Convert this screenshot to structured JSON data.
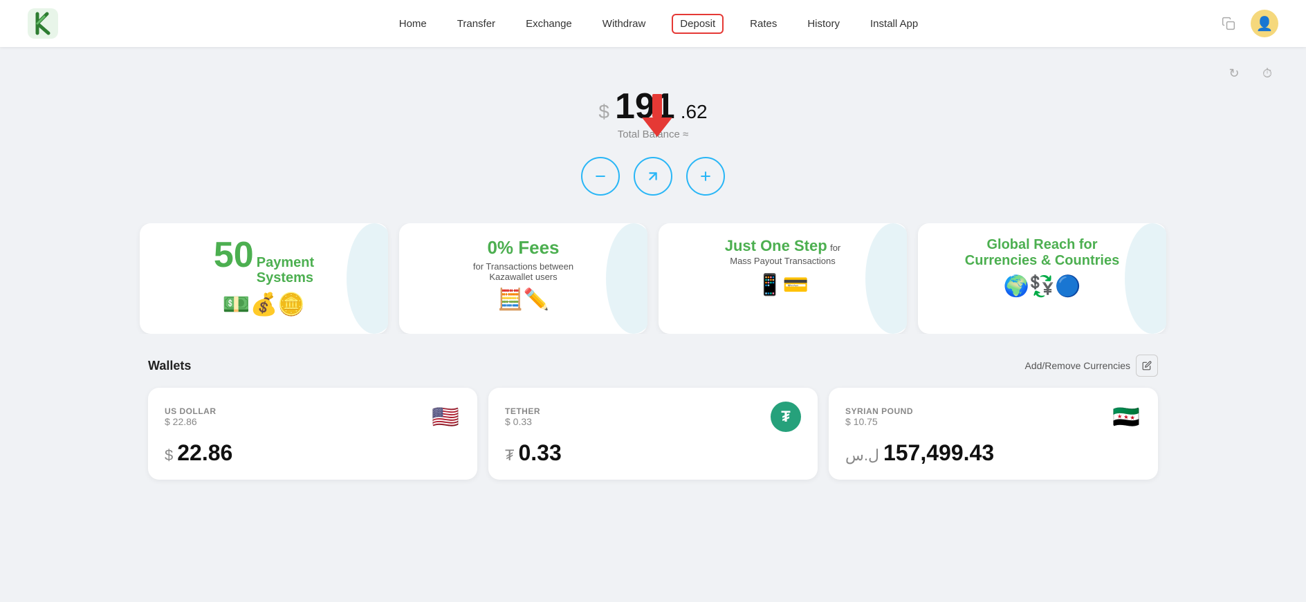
{
  "app": {
    "logo_letter": "K"
  },
  "nav": {
    "items": [
      {
        "label": "Home",
        "id": "home",
        "active": false
      },
      {
        "label": "Transfer",
        "id": "transfer",
        "active": false
      },
      {
        "label": "Exchange",
        "id": "exchange",
        "active": false
      },
      {
        "label": "Withdraw",
        "id": "withdraw",
        "active": false
      },
      {
        "label": "Deposit",
        "id": "deposit",
        "active": true
      },
      {
        "label": "Rates",
        "id": "rates",
        "active": false
      },
      {
        "label": "History",
        "id": "history",
        "active": false
      },
      {
        "label": "Install App",
        "id": "install",
        "active": false
      }
    ]
  },
  "balance": {
    "dollar_sign": "$",
    "main": "191",
    "cents": ".62",
    "label": "Total Balance ≈"
  },
  "actions": {
    "withdraw_label": "−",
    "send_label": "↗",
    "deposit_label": "+"
  },
  "banners": [
    {
      "big_text": "50",
      "title_rest": "Payment\nSystems",
      "img_emoji": "💵💰"
    },
    {
      "big_text": "0% Fees",
      "subtitle": "for Transactions between\nKazawallet users",
      "img_emoji": "🧮✏️"
    },
    {
      "big_text": "Just One Step",
      "subtitle": "for\nMass Payout Transactions",
      "img_emoji": "📱💳"
    },
    {
      "big_text": "Global Reach for",
      "subtitle": "Currencies & Countries",
      "img_emoji": "🌍💱"
    }
  ],
  "wallets": {
    "section_title": "Wallets",
    "add_remove_label": "Add/Remove Currencies",
    "cards": [
      {
        "name": "US DOLLAR",
        "usd_value": "$ 22.86",
        "balance_sign": "$",
        "balance": "22.86",
        "flag": "🇺🇸",
        "flag_type": "emoji"
      },
      {
        "name": "TETHER",
        "usd_value": "$ 0.33",
        "balance_sign": "₮",
        "balance": "0.33",
        "flag": "₮",
        "flag_type": "tether"
      },
      {
        "name": "SYRIAN POUND",
        "usd_value": "$ 10.75",
        "balance_sign": "ل.س",
        "balance": "157,499.43",
        "flag": "🇸🇾",
        "flag_type": "emoji"
      }
    ]
  },
  "utility": {
    "refresh_icon": "↻",
    "history_icon": "⏱"
  }
}
